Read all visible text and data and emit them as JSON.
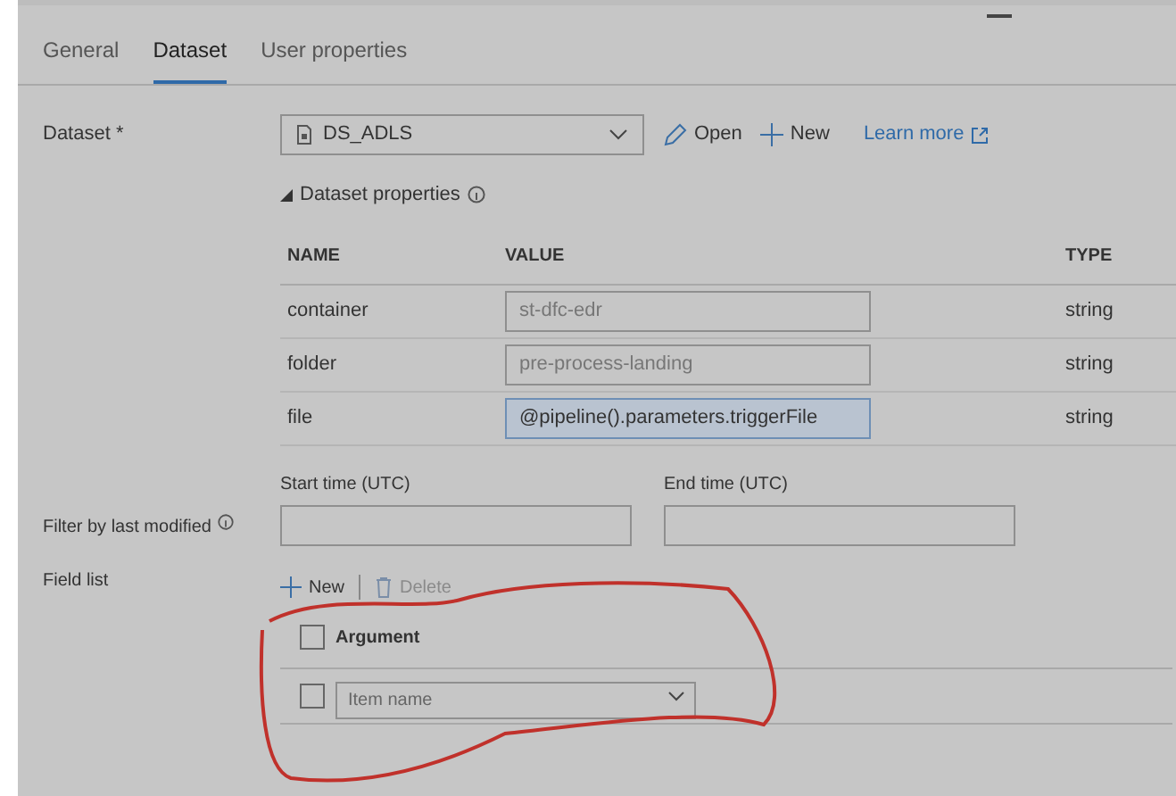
{
  "tabs": [
    {
      "label": "General",
      "selected": false
    },
    {
      "label": "Dataset",
      "selected": true
    },
    {
      "label": "User properties",
      "selected": false
    }
  ],
  "dataset": {
    "label": "Dataset *",
    "value": "DS_ADLS",
    "open": "Open",
    "new": "New",
    "learn_more": "Learn more"
  },
  "dataset_properties": {
    "title": "Dataset properties",
    "expanded": true,
    "columns": [
      "NAME",
      "VALUE",
      "TYPE"
    ],
    "rows": [
      {
        "name": "container",
        "placeholder": "st-dfc-edr",
        "type": "string",
        "focused": false
      },
      {
        "name": "folder",
        "placeholder": "pre-process-landing",
        "type": "string",
        "focused": false
      },
      {
        "name": "file",
        "value": "@pipeline().parameters.triggerFile",
        "type": "string",
        "focused": true
      }
    ]
  },
  "filter": {
    "label": "Filter by last modified",
    "start_label": "Start time (UTC)",
    "end_label": "End time (UTC)"
  },
  "field_list": {
    "label": "Field list",
    "new": "New",
    "delete": "Delete",
    "header": {
      "label": "Argument",
      "checked": false
    },
    "rows": [
      {
        "placeholder": "Item name",
        "checked": false
      }
    ]
  }
}
